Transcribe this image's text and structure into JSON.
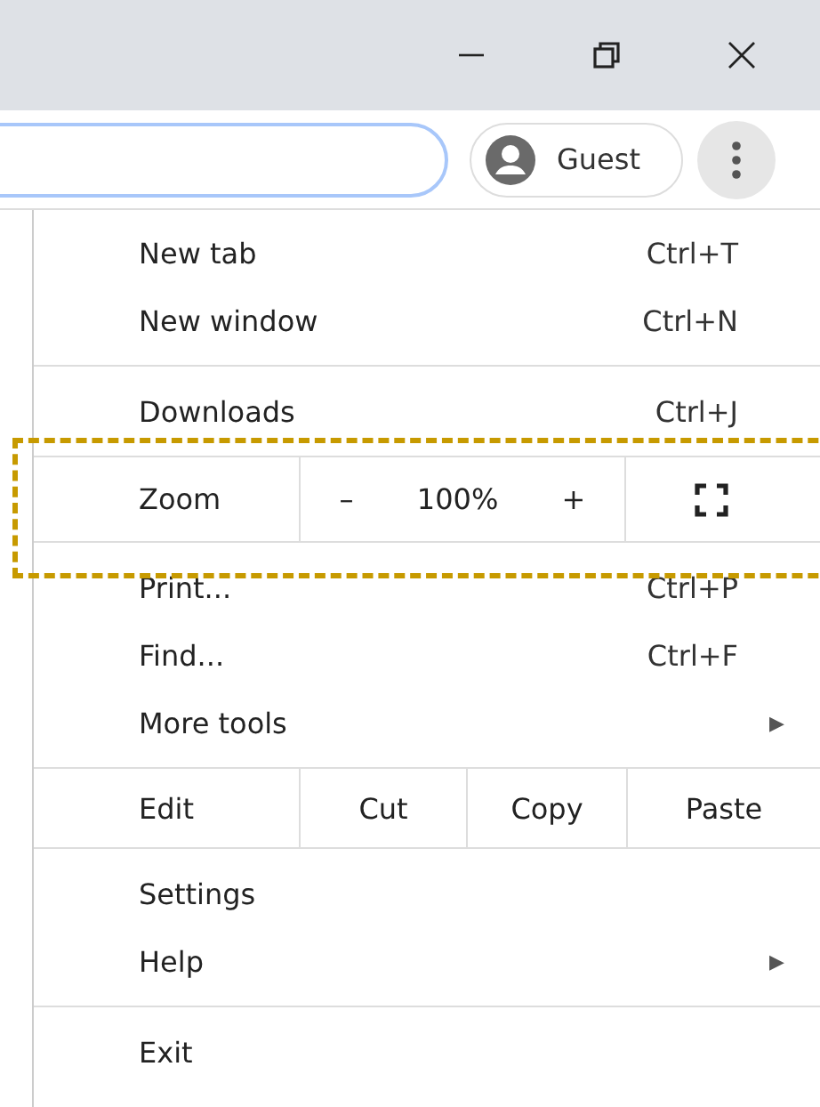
{
  "toolbar": {
    "profile_button": {
      "label": "Guest"
    }
  },
  "menu": [
    {
      "kind": "item",
      "label": "New tab",
      "shortcut": "Ctrl+T"
    },
    {
      "kind": "item",
      "label": "New window",
      "shortcut": "Ctrl+N"
    },
    {
      "kind": "separator"
    },
    {
      "kind": "item",
      "label": "Downloads",
      "shortcut": "Ctrl+J"
    },
    {
      "kind": "zoom",
      "label": "Zoom",
      "minus": "–",
      "value": "100%",
      "plus": "+"
    },
    {
      "kind": "item",
      "label": "Print...",
      "shortcut": "Ctrl+P"
    },
    {
      "kind": "item",
      "label": "Find...",
      "shortcut": "Ctrl+F"
    },
    {
      "kind": "submenu",
      "label": "More tools",
      "arrow": "▶"
    },
    {
      "kind": "edit",
      "label": "Edit",
      "actions": [
        "Cut",
        "Copy",
        "Paste"
      ]
    },
    {
      "kind": "item",
      "label": "Settings"
    },
    {
      "kind": "submenu",
      "label": "Help",
      "arrow": "▶"
    },
    {
      "kind": "separator"
    },
    {
      "kind": "item",
      "label": "Exit"
    }
  ]
}
